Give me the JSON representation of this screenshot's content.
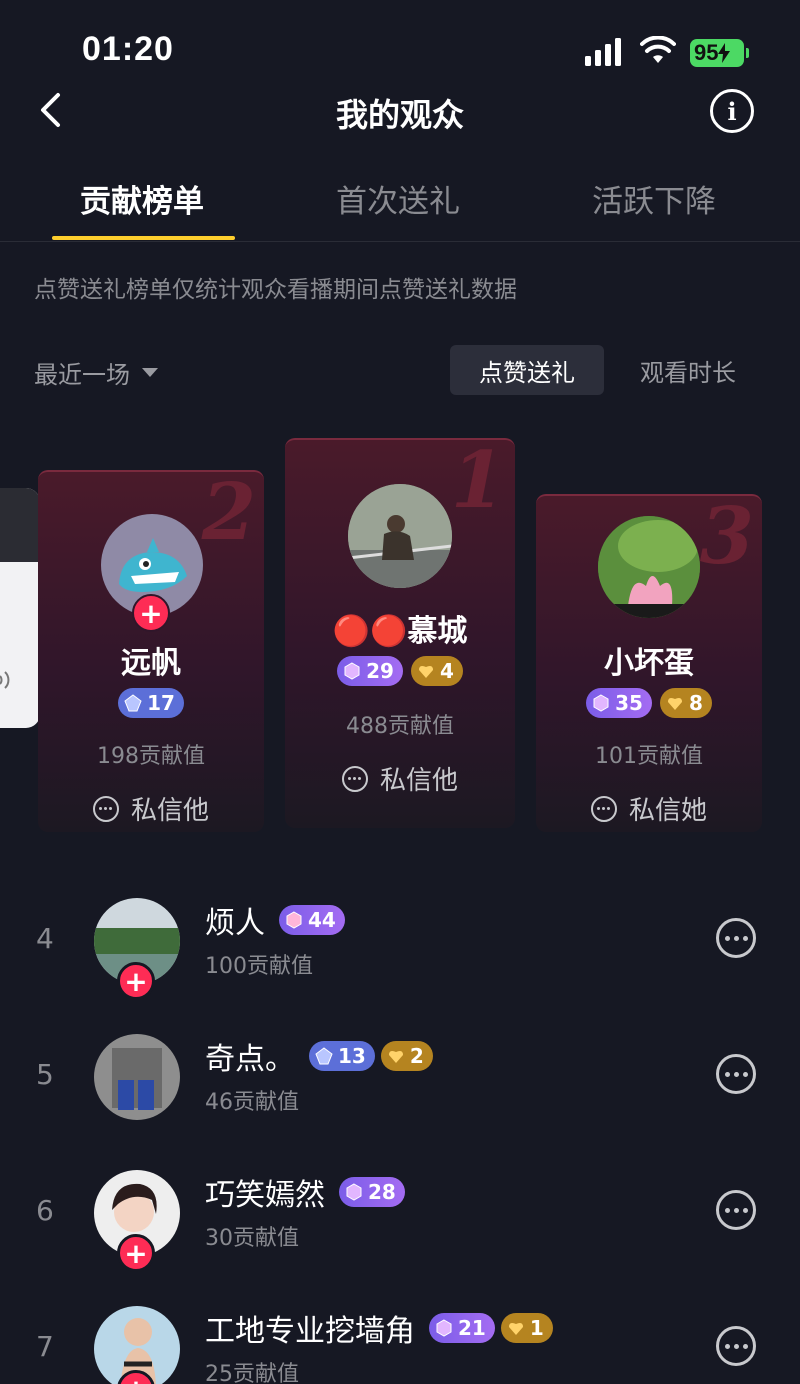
{
  "status": {
    "time": "01:20",
    "battery": "95"
  },
  "nav": {
    "title": "我的观众"
  },
  "tabs": [
    {
      "label": "贡献榜单",
      "active": true
    },
    {
      "label": "首次送礼",
      "active": false
    },
    {
      "label": "活跃下降",
      "active": false
    }
  ],
  "hint": "点赞送礼榜单仅统计观众看播期间点赞送礼数据",
  "filter": {
    "range": "最近一场",
    "seg_selected": "点赞送礼",
    "seg_other": "观看时长"
  },
  "podium": [
    {
      "rank": "2",
      "name": "远帆",
      "badges": [
        {
          "type": "blue",
          "value": "17"
        }
      ],
      "contrib": "198贡献值",
      "dm": "私信他"
    },
    {
      "rank": "1",
      "name": "🔴🔴慕城",
      "badges": [
        {
          "type": "purple",
          "value": "29"
        },
        {
          "type": "gold",
          "value": "4"
        }
      ],
      "contrib": "488贡献值",
      "dm": "私信他"
    },
    {
      "rank": "3",
      "name": "小坏蛋",
      "badges": [
        {
          "type": "purple",
          "value": "35"
        },
        {
          "type": "gold",
          "value": "8"
        }
      ],
      "contrib": "101贡献值",
      "dm": "私信她"
    }
  ],
  "add_symbol": "+",
  "list": [
    {
      "rank": "4",
      "name": "烦人",
      "badges": [
        {
          "type": "purple",
          "value": "44"
        }
      ],
      "contrib": "100贡献值"
    },
    {
      "rank": "5",
      "name": "奇点。",
      "badges": [
        {
          "type": "blue",
          "value": "13"
        },
        {
          "type": "gold",
          "value": "2"
        }
      ],
      "contrib": "46贡献值"
    },
    {
      "rank": "6",
      "name": "巧笑嫣然",
      "badges": [
        {
          "type": "purple",
          "value": "28"
        }
      ],
      "contrib": "30贡献值"
    },
    {
      "rank": "7",
      "name": "工地专业挖墙角",
      "badges": [
        {
          "type": "purple",
          "value": "21"
        },
        {
          "type": "gold",
          "value": "1"
        }
      ],
      "contrib": "25贡献值"
    }
  ],
  "colors": {
    "accent": "#fece2d",
    "add": "#fe2c55",
    "bg": "#161823"
  }
}
